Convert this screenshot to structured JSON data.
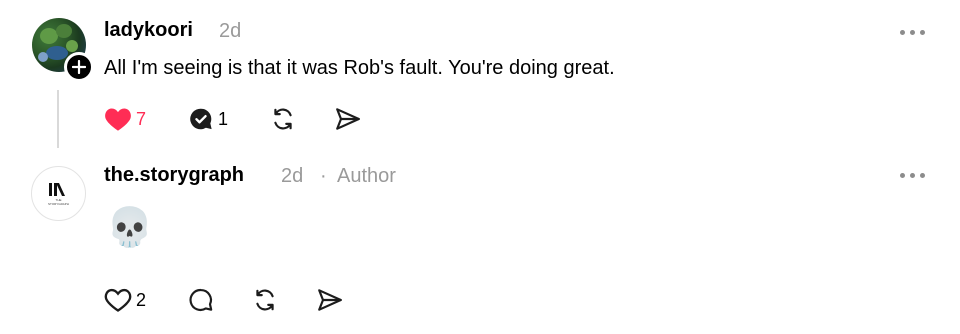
{
  "comments": [
    {
      "username": "ladykoori",
      "time": "2d",
      "text": "All I'm seeing is that it was Rob's fault. You're doing great.",
      "likes": "7",
      "replies": "1",
      "like_color": "#ff2d55",
      "liked": true
    },
    {
      "username": "the.storygraph",
      "time": "2d",
      "separator": "·",
      "role": "Author",
      "text": "💀",
      "likes": "2",
      "avatar_caption": "THE STORYGRAPH"
    }
  ],
  "icons": {
    "like": "heart-icon",
    "reply": "comment-icon",
    "repost": "repost-icon",
    "share": "send-icon",
    "more": "more-icon",
    "follow": "plus-icon"
  }
}
